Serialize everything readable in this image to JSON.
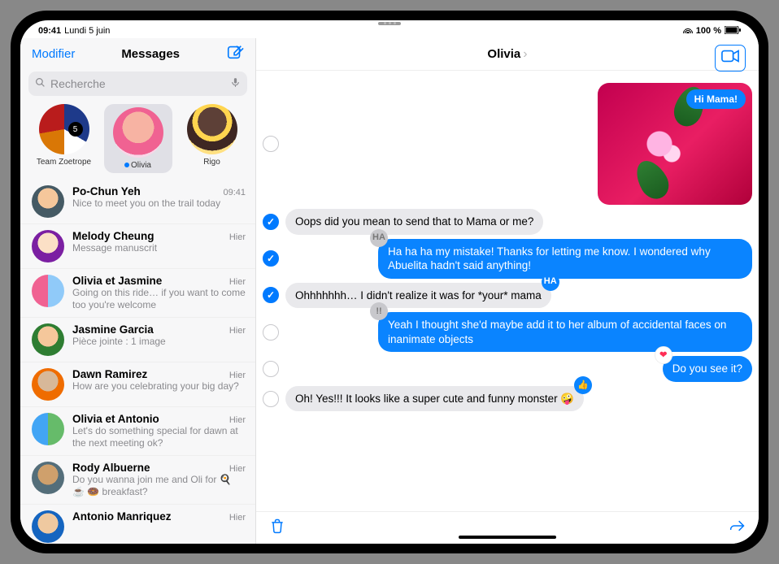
{
  "status": {
    "time": "09:41",
    "date": "Lundi 5 juin",
    "battery": "100 %"
  },
  "sidebar": {
    "edit": "Modifier",
    "title": "Messages",
    "search_placeholder": "Recherche",
    "pinned": [
      {
        "name": "Team Zoetrope",
        "selected": false,
        "unread": false
      },
      {
        "name": "Olivia",
        "selected": true,
        "unread": true
      },
      {
        "name": "Rigo",
        "selected": false,
        "unread": false
      }
    ],
    "conversations": [
      {
        "name": "Po-Chun Yeh",
        "time": "09:41",
        "preview": "Nice to meet you on the trail today"
      },
      {
        "name": "Melody Cheung",
        "time": "Hier",
        "preview": "Message manuscrit"
      },
      {
        "name": "Olivia et Jasmine",
        "time": "Hier",
        "preview": "Going on this ride… if you want to come too you're welcome"
      },
      {
        "name": "Jasmine Garcia",
        "time": "Hier",
        "preview": "Pièce jointe : 1 image"
      },
      {
        "name": "Dawn Ramirez",
        "time": "Hier",
        "preview": "How are you celebrating your big day?"
      },
      {
        "name": "Olivia et Antonio",
        "time": "Hier",
        "preview": "Let's do something special for dawn at the next meeting ok?"
      },
      {
        "name": "Rody Albuerne",
        "time": "Hier",
        "preview": "Do you wanna join me and Oli for 🍳 ☕ 🍩 breakfast?"
      },
      {
        "name": "Antonio Manriquez",
        "time": "Hier",
        "preview": ""
      }
    ]
  },
  "thread": {
    "title": "Olivia",
    "image_caption": "Hi Mama!",
    "messages": [
      {
        "dir": "in",
        "sel": true,
        "text": "Oops did you mean to send that to Mama or me?",
        "tb": null
      },
      {
        "dir": "out",
        "sel": true,
        "text": "Ha ha ha my mistake! Thanks for letting me know. I wondered why Abuelita hadn't said anything!",
        "tb": "haha-gray"
      },
      {
        "dir": "in",
        "sel": true,
        "text": "Ohhhhhhh… I didn't realize it was for *your* mama",
        "tb": "haha"
      },
      {
        "dir": "out",
        "sel": false,
        "text": "Yeah I thought she'd maybe add it to her album of accidental faces on inanimate objects",
        "tb": "excl"
      },
      {
        "dir": "out",
        "sel": false,
        "text": "Do you see it?",
        "tb": "heart"
      },
      {
        "dir": "in",
        "sel": false,
        "text": "Oh! Yes!!! It looks like a super cute and funny monster 🤪",
        "tb": "like"
      }
    ]
  }
}
